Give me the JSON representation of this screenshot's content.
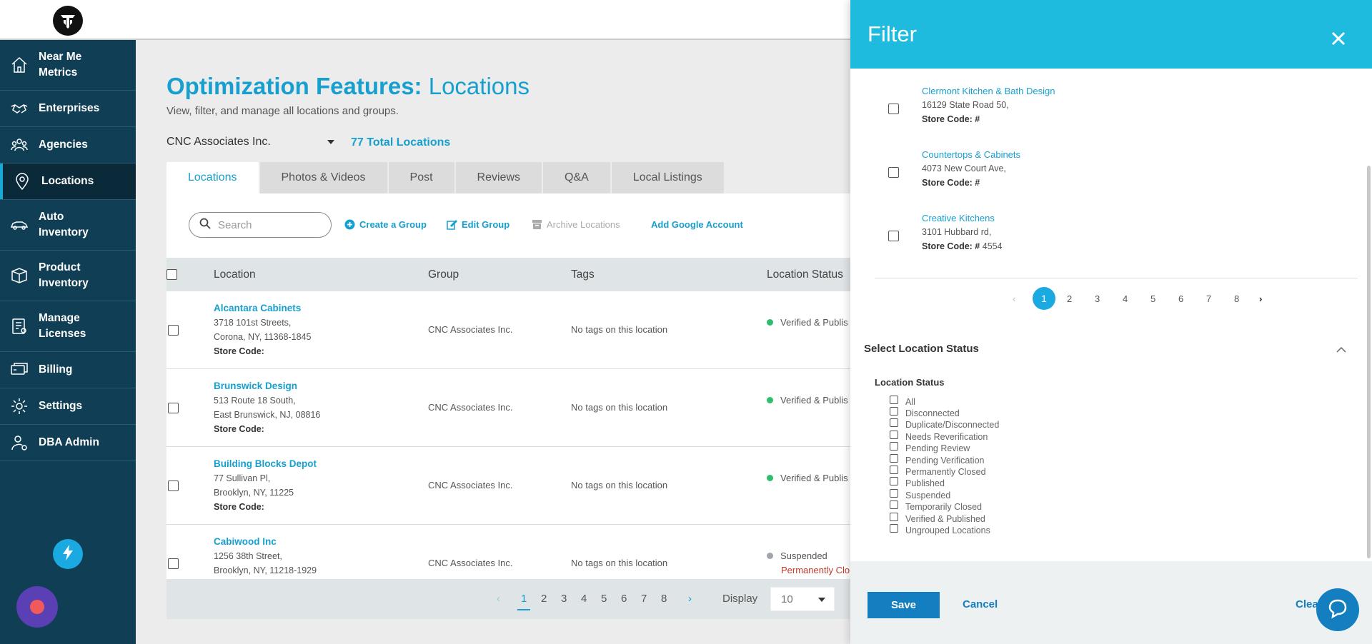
{
  "sidebar": {
    "items": [
      {
        "label": "Near Me Metrics",
        "icon": "home-icon"
      },
      {
        "label": "Enterprises",
        "icon": "handshake-icon"
      },
      {
        "label": "Agencies",
        "icon": "agency-icon"
      },
      {
        "label": "Locations",
        "icon": "map-pin-icon",
        "active": true
      },
      {
        "label": "Auto Inventory",
        "icon": "car-icon"
      },
      {
        "label": "Product Inventory",
        "icon": "box-icon"
      },
      {
        "label": "Manage Licenses",
        "icon": "license-icon"
      },
      {
        "label": "Billing",
        "icon": "billing-icon"
      },
      {
        "label": "Settings",
        "icon": "gear-icon"
      },
      {
        "label": "DBA Admin",
        "icon": "user-admin-icon"
      }
    ]
  },
  "main": {
    "title_bold": "Optimization Features:",
    "title_rest": " Locations",
    "subtitle": "View, filter, and manage all locations and groups.",
    "company": "CNC Associates Inc.",
    "total_locations": "77 Total Locations",
    "tabs": [
      "Locations",
      "Photos & Videos",
      "Post",
      "Reviews",
      "Q&A",
      "Local Listings"
    ],
    "search_placeholder": "Search",
    "toolbar": {
      "create_group": "Create a Group",
      "edit_group": "Edit Group",
      "archive_locations": "Archive Locations",
      "add_google_account": "Add Google Account"
    },
    "table": {
      "headers": [
        "Location",
        "Group",
        "Tags",
        "Location Status"
      ],
      "rows": [
        {
          "name": "Alcantara Cabinets",
          "addr1": "3718 101st Streets,",
          "addr2": "Corona, NY, 11368-1845",
          "code": "Store Code:",
          "group": "CNC Associates Inc.",
          "tags": "No tags on this location",
          "status": "Verified & Publis",
          "status_color": "#2ebd6b",
          "status2": ""
        },
        {
          "name": "Brunswick Design",
          "addr1": "513 Route 18 South,",
          "addr2": "East Brunswick, NJ, 08816",
          "code": "Store Code:",
          "group": "CNC Associates Inc.",
          "tags": "No tags on this location",
          "status": "Verified & Publis",
          "status_color": "#2ebd6b",
          "status2": ""
        },
        {
          "name": "Building Blocks Depot",
          "addr1": "77 Sullivan Pl,",
          "addr2": "Brooklyn, NY, 11225",
          "code": "Store Code:",
          "group": "CNC Associates Inc.",
          "tags": "No tags on this location",
          "status": "Verified & Publis",
          "status_color": "#2ebd6b",
          "status2": ""
        },
        {
          "name": "Cabiwood Inc",
          "addr1": "1256 38th Street,",
          "addr2": "Brooklyn, NY, 11218-1929",
          "code": "",
          "group": "CNC Associates Inc.",
          "tags": "No tags on this location",
          "status": "Suspended",
          "status_color": "#a0a4ad",
          "status2": "Permanently Clo"
        }
      ]
    },
    "pagination": {
      "pages": [
        "1",
        "2",
        "3",
        "4",
        "5",
        "6",
        "7",
        "8"
      ],
      "current": "1",
      "display_label": "Display",
      "display_value": "10"
    }
  },
  "filter": {
    "title": "Filter",
    "locations": [
      {
        "name": "Clermont Kitchen & Bath Design",
        "addr": "16129 State Road 50,",
        "code_label": "Store Code: #",
        "code": ""
      },
      {
        "name": "Countertops & Cabinets",
        "addr": "4073 New Court Ave,",
        "code_label": "Store Code: #",
        "code": ""
      },
      {
        "name": "Creative Kitchens",
        "addr": "3101 Hubbard rd,",
        "code_label": "Store Code: #",
        "code": " 4554"
      }
    ],
    "pagination": {
      "pages": [
        "1",
        "2",
        "3",
        "4",
        "5",
        "6",
        "7",
        "8"
      ],
      "current": "1"
    },
    "section_title": "Select Location Status",
    "status_label": "Location Status",
    "status_options": [
      "All",
      "Disconnected",
      "Duplicate/Disconnected",
      "Needs Reverification",
      "Pending Review",
      "Pending Verification",
      "Permanently Closed",
      "Published",
      "Suspended",
      "Temporarily Closed",
      "Verified & Published",
      "Ungrouped Locations"
    ],
    "save": "Save",
    "cancel": "Cancel",
    "clear": "Clea"
  }
}
